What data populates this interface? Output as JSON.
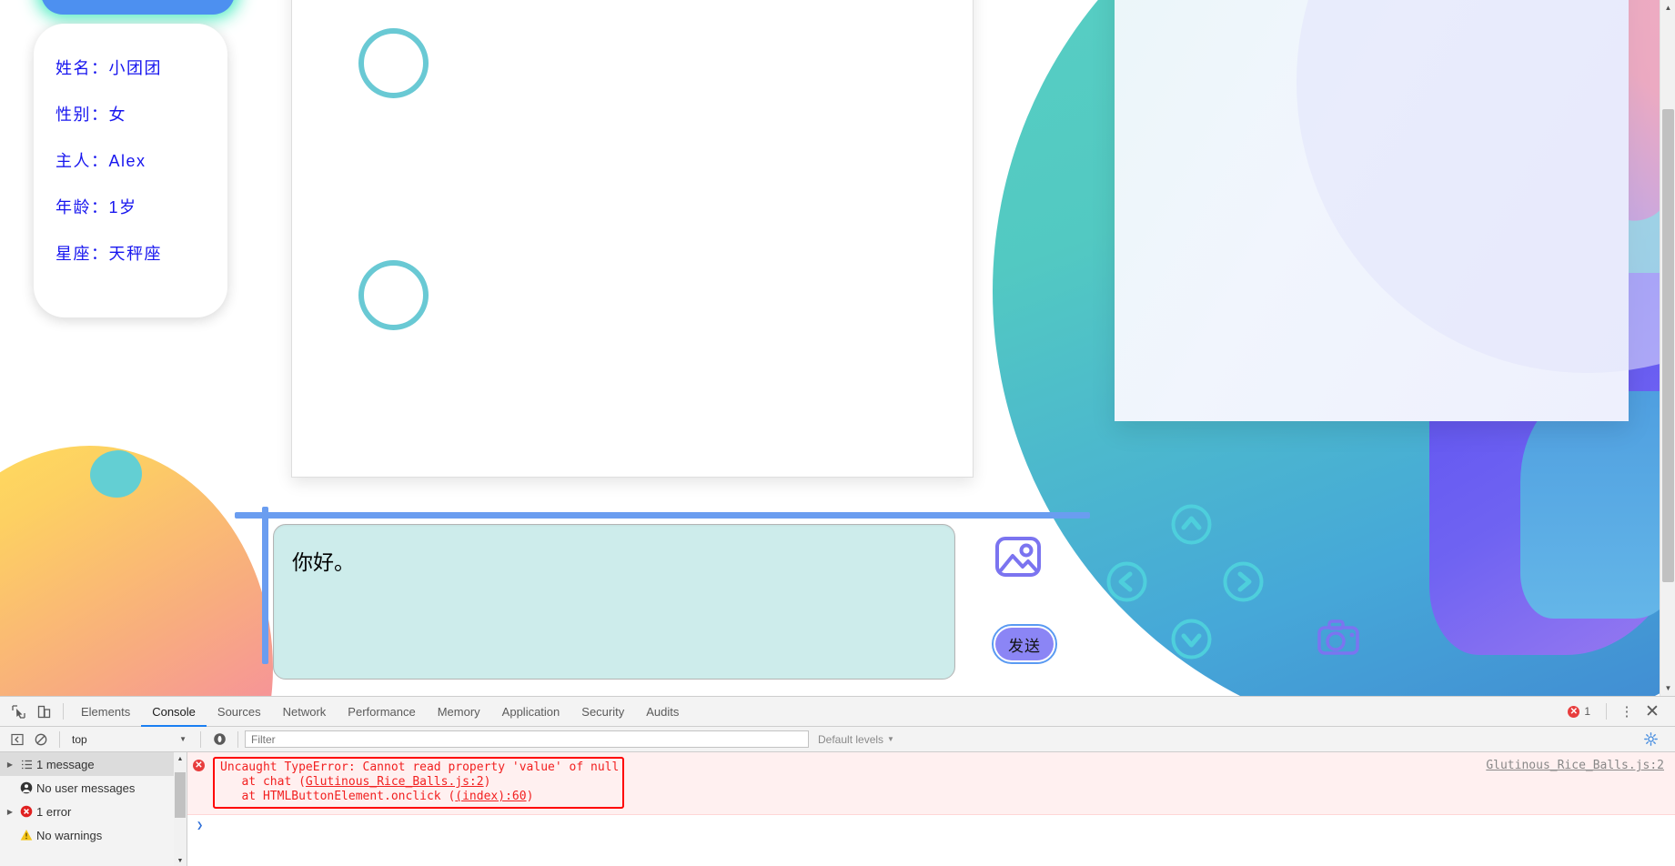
{
  "pet_card": {
    "rows": [
      "姓名：小团团",
      "性别：女",
      "主人：Alex",
      "年龄：1岁",
      "星座：天秤座"
    ]
  },
  "chat": {
    "input_value": "你好。",
    "input_placeholder": "",
    "send_label": "发送",
    "image_icon_name": "image-icon",
    "camera_icon_name": "camera-icon",
    "dpad": {
      "up": "up-arrow-icon",
      "left": "left-arrow-icon",
      "right": "right-arrow-icon",
      "down": "down-arrow-icon"
    }
  },
  "devtools": {
    "tabs": [
      "Elements",
      "Console",
      "Sources",
      "Network",
      "Performance",
      "Memory",
      "Application",
      "Security",
      "Audits"
    ],
    "active_tab": "Console",
    "error_count": "1",
    "filterbar": {
      "context": "top",
      "filter_placeholder": "Filter",
      "filter_value": "",
      "levels": "Default levels"
    },
    "sidebar": [
      {
        "label": "1 message",
        "icon": "list-icon",
        "expandable": true,
        "selected": true
      },
      {
        "label": "No user messages",
        "icon": "user-icon",
        "expandable": false,
        "selected": false
      },
      {
        "label": "1 error",
        "icon": "error-icon",
        "expandable": true,
        "selected": false
      },
      {
        "label": "No warnings",
        "icon": "warning-icon",
        "expandable": false,
        "selected": false
      }
    ],
    "console_message": {
      "line1": "Uncaught TypeError: Cannot read property 'value' of null",
      "line2_prefix": "   at chat (",
      "line2_link": "Glutinous_Rice_Balls.js:2",
      "line2_suffix": ")",
      "line3_prefix": "   at HTMLButtonElement.onclick (",
      "line3_link": "(index):60",
      "line3_suffix": ")",
      "source_link": "Glutinous_Rice_Balls.js:2"
    },
    "prompt_caret": "❯"
  },
  "colors": {
    "accent_blue": "#6a9df0",
    "teal": "#69c9d4",
    "purple": "#8b85f5",
    "error_red": "#f22020",
    "info_text": "#1816ef",
    "input_bg": "#cdeceb"
  }
}
